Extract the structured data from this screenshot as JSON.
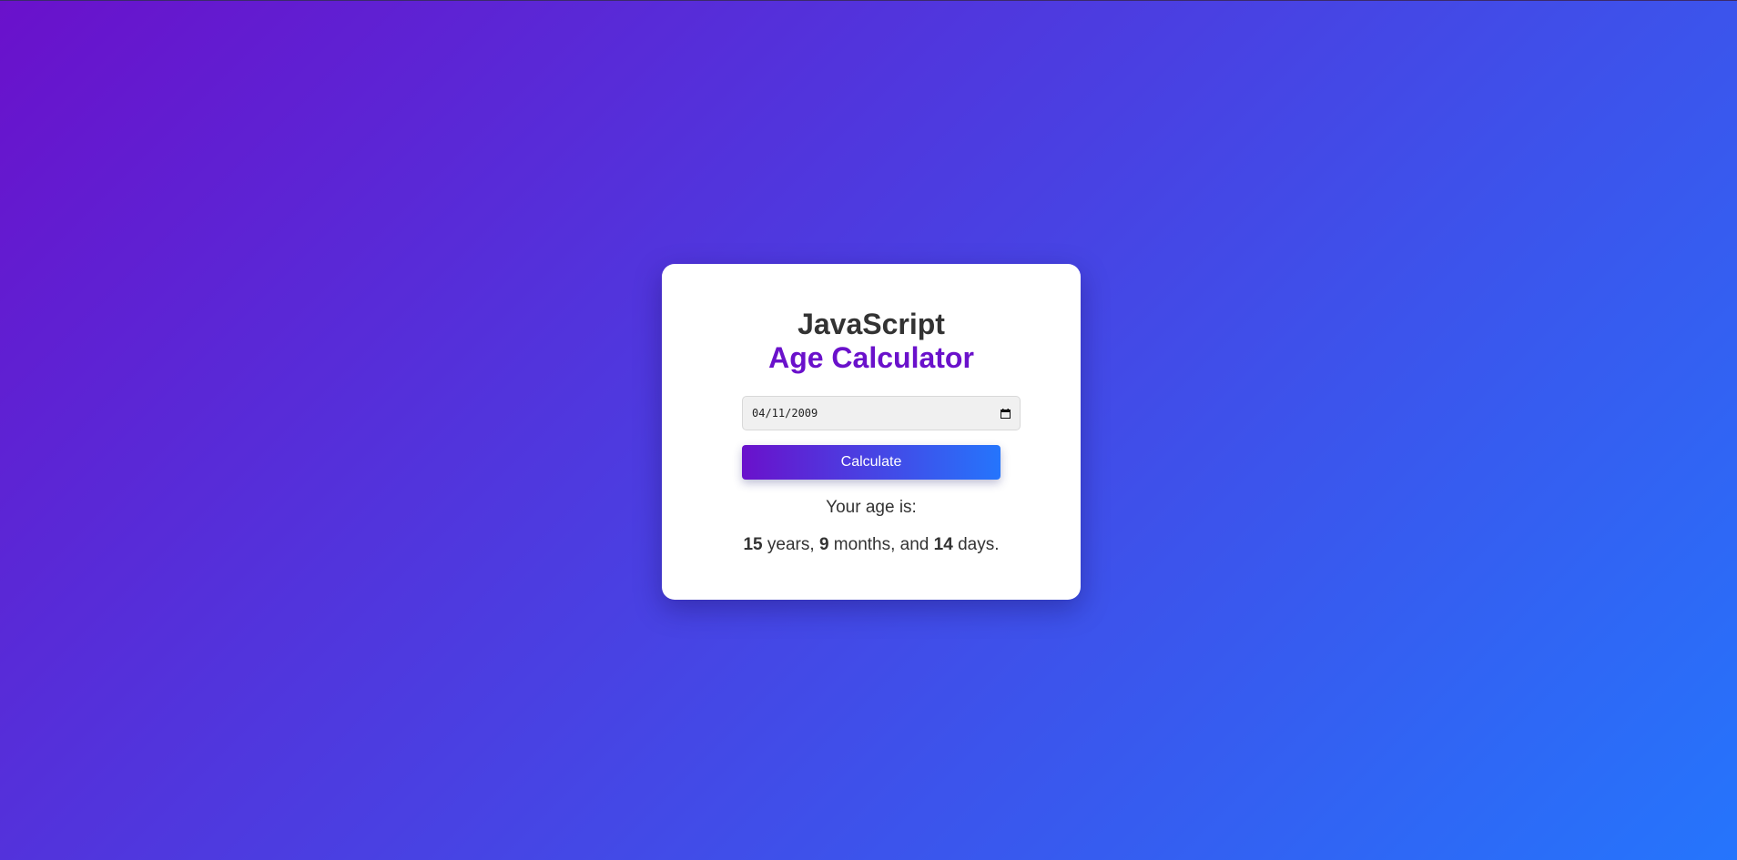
{
  "header": {
    "title_line1": "JavaScript",
    "title_line2": "Age Calculator"
  },
  "date_input": {
    "value": "04/11/2009",
    "icon": "calendar-icon"
  },
  "calculate_button": {
    "label": "Calculate"
  },
  "result": {
    "label": "Your age is:",
    "years": "15",
    "years_word": "years,",
    "months": "9",
    "months_word": "months, and",
    "days": "14",
    "days_word": "days."
  },
  "colors": {
    "gradient_start": "#6a11cb",
    "gradient_end": "#2575fc",
    "title_dark": "#333333",
    "title_accent": "#6a11cb"
  }
}
